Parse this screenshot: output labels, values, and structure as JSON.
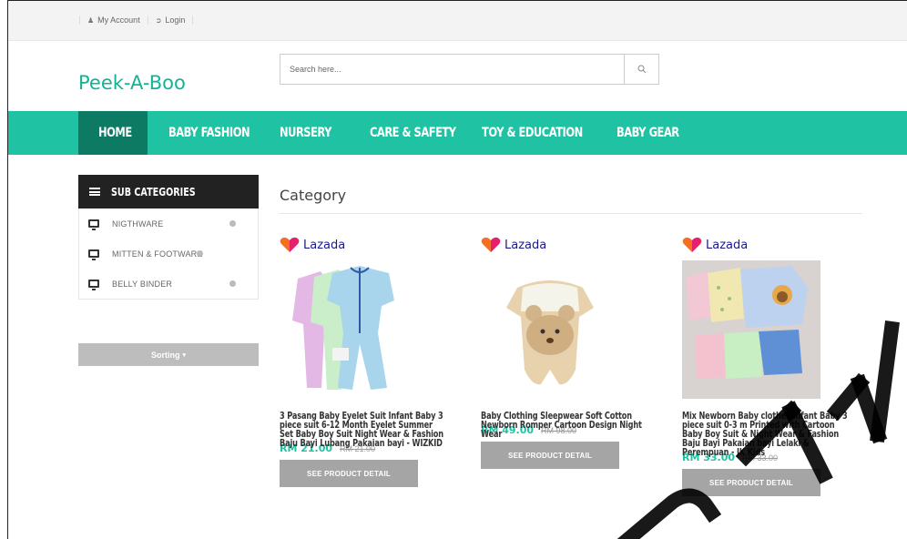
{
  "topbar": {
    "links": [
      {
        "icon": "user-icon",
        "label": "My Account"
      },
      {
        "icon": "login-icon",
        "label": "Login"
      }
    ]
  },
  "header": {
    "logo": "Peek-A-Boo",
    "search_placeholder": "Search here..."
  },
  "nav": {
    "items": [
      "HOME",
      "BABY FASHION",
      "NURSERY",
      "CARE & SAFETY",
      "TOY & EDUCATION",
      "BABY GEAR"
    ],
    "active": "HOME"
  },
  "sidebar": {
    "title": "SUB CATEGORIES",
    "items": [
      "NIGTHWARE",
      "MITTEN & FOOTWARE",
      "BELLY BINDER"
    ],
    "sorting_label": "Sorting"
  },
  "main": {
    "title": "Category",
    "products": [
      {
        "brand": "Lazada",
        "name": "3 Pasang Baby Eyelet Suit Infant Baby 3 piece suit 6-12 Month Eyelet Summer Set Baby Boy Suit Night Wear & Fashion Baju Bayi Lubang Pakaian bayi - WIZKID",
        "price": "RM 21.00",
        "old_price": "RM 21.00",
        "button": "SEE PRODUCT DETAIL"
      },
      {
        "brand": "Lazada",
        "name": "Baby Clothing Sleepwear Soft Cotton Newborn Romper Cartoon Design Night Wear",
        "price": "RM 49.00",
        "old_price": "RM 98.00",
        "button": "SEE PRODUCT DETAIL"
      },
      {
        "brand": "Lazada",
        "name": "Mix Newborn Baby clothes Infant Baby 3 piece suit 0-3 m Printed with Cartoon Baby Boy Suit & Night Wear & Fashion Baju Bayi Pakaian bayi Lelaki & Perempuan - JK Kids",
        "price": "RM 33.00",
        "old_price": "RM 33.00",
        "button": "SEE PRODUCT DETAIL"
      }
    ]
  },
  "colors": {
    "accent": "#1fc2a2",
    "nav_active": "#0d7a64",
    "logo": "#13b395",
    "brand_text": "#1a1a8c"
  }
}
